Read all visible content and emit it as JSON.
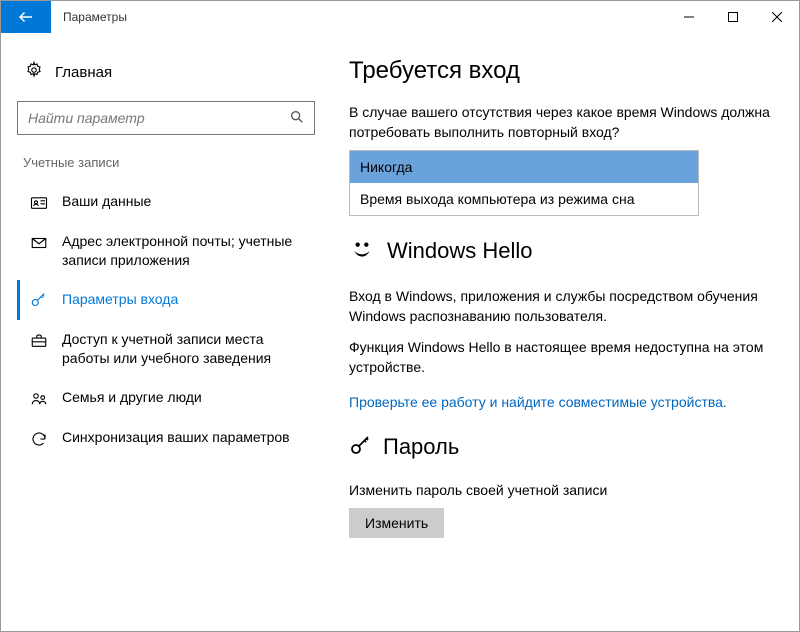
{
  "window": {
    "title": "Параметры"
  },
  "sidebar": {
    "home": "Главная",
    "search_placeholder": "Найти параметр",
    "section": "Учетные записи",
    "items": [
      {
        "label": "Ваши данные"
      },
      {
        "label": "Адрес электронной почты; учетные записи приложения"
      },
      {
        "label": "Параметры входа"
      },
      {
        "label": "Доступ к учетной записи места работы или учебного заведения"
      },
      {
        "label": "Семья и другие люди"
      },
      {
        "label": "Синхронизация ваших параметров"
      }
    ]
  },
  "main": {
    "signin_heading": "Требуется вход",
    "signin_prompt": "В случае вашего отсутствия через какое время Windows должна потребовать выполнить повторный вход?",
    "dropdown": {
      "selected": "Никогда",
      "other": "Время выхода компьютера из режима сна"
    },
    "hello": {
      "title": "Windows Hello",
      "desc1": "Вход в Windows, приложения и службы посредством обучения Windows распознаванию пользователя.",
      "desc2": "Функция Windows Hello в настоящее время недоступна на этом устройстве.",
      "link": "Проверьте ее работу и найдите совместимые устройства."
    },
    "password": {
      "title": "Пароль",
      "desc": "Изменить пароль своей учетной записи",
      "button": "Изменить"
    }
  }
}
